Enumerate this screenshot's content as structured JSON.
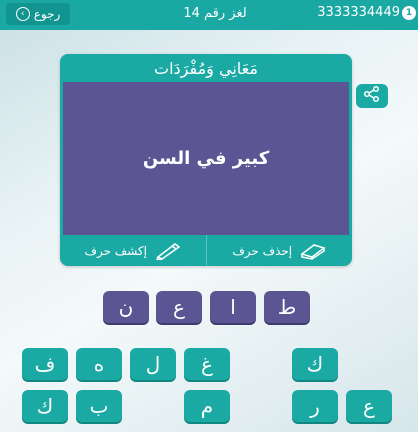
{
  "header": {
    "back_label": "رجوع",
    "level_label": "لغز رقم 14",
    "coins": "3333334449",
    "coin_symbol": "1"
  },
  "puzzle": {
    "category": "مَعَانِي وَمُفْرَدَات",
    "clue": "كبير في السن"
  },
  "hints": {
    "reveal_label": "إكشف حرف",
    "delete_label": "إحذف حرف"
  },
  "answer_tiles": [
    "ن",
    "ع",
    "ا",
    "ط"
  ],
  "keyboard": {
    "row1": [
      "ف",
      "ه",
      "ل",
      "غ",
      "ك"
    ],
    "row2": [
      "ك",
      "ب",
      "م",
      "ر",
      "ع"
    ]
  },
  "colors": {
    "teal": "#1ba9a4",
    "purple": "#5b5593"
  }
}
